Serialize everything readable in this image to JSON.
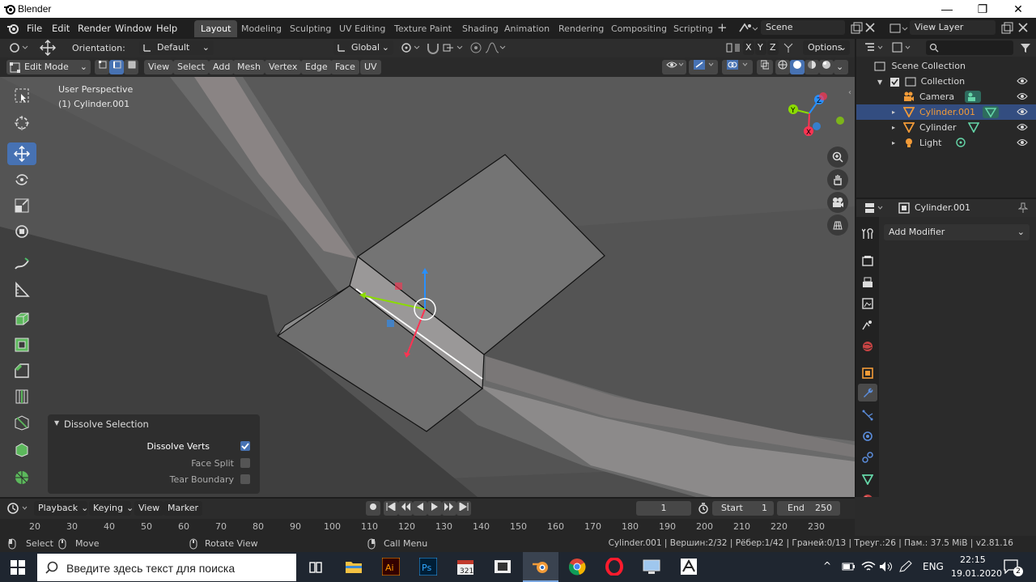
{
  "window": {
    "title": "Blender",
    "minimize": "—",
    "maximize": "❐",
    "close": "✕"
  },
  "menus": [
    "File",
    "Edit",
    "Render",
    "Window",
    "Help"
  ],
  "workspace_tabs": [
    {
      "label": "Layout",
      "active": true
    },
    {
      "label": "Modeling"
    },
    {
      "label": "Sculpting"
    },
    {
      "label": "UV Editing"
    },
    {
      "label": "Texture Paint"
    },
    {
      "label": "Shading"
    },
    {
      "label": "Animation"
    },
    {
      "label": "Rendering"
    },
    {
      "label": "Compositing"
    },
    {
      "label": "Scripting"
    }
  ],
  "add_workspace": "+",
  "scene": "Scene",
  "view_layer": "View Layer",
  "tool_header": {
    "orientation_label": "Orientation:",
    "orientation_value": "Default",
    "transform_orientation": "Global",
    "axis_x": "X",
    "axis_y": "Y",
    "axis_z": "Z",
    "options": "Options"
  },
  "viewport_header": {
    "mode": "Edit Mode",
    "menus": [
      "View",
      "Select",
      "Add",
      "Mesh",
      "Vertex",
      "Edge",
      "Face",
      "UV"
    ]
  },
  "viewport": {
    "perspective": "User Perspective",
    "object": "(1) Cylinder.001"
  },
  "dissolve": {
    "title": "Dissolve Selection",
    "options": [
      {
        "label": "Dissolve Verts",
        "checked": true
      },
      {
        "label": "Face Split",
        "checked": false
      },
      {
        "label": "Tear Boundary",
        "checked": false
      }
    ]
  },
  "outliner": {
    "scene_collection": "Scene Collection",
    "collection": "Collection",
    "items": [
      {
        "name": "Camera",
        "selected": false
      },
      {
        "name": "Cylinder.001",
        "selected": true
      },
      {
        "name": "Cylinder",
        "selected": false
      },
      {
        "name": "Light",
        "selected": false
      }
    ]
  },
  "properties": {
    "object": "Cylinder.001",
    "add_modifier": "Add Modifier"
  },
  "timeline": {
    "menus": [
      "Playback",
      "Keying",
      "View",
      "Marker"
    ],
    "current_frame": "1",
    "start_label": "Start",
    "start": "1",
    "end_label": "End",
    "end": "250",
    "ruler": [
      "20",
      "30",
      "40",
      "50",
      "60",
      "70",
      "80",
      "90",
      "100",
      "110",
      "120",
      "130",
      "140",
      "150",
      "160",
      "170",
      "180",
      "190",
      "200",
      "210",
      "220",
      "230"
    ]
  },
  "statusbar": {
    "select": "Select",
    "move": "Move",
    "rotate": "Rotate View",
    "call_menu": "Call Menu",
    "stats": "Cylinder.001 | Вершин:2/32 | Рёбер:1/42 | Граней:0/13 | Треуг.:26 | Пам.: 37.5 MiB | v2.81.16"
  },
  "taskbar": {
    "search_placeholder": "Введите здесь текст для поиска",
    "lang": "ENG",
    "time": "22:15",
    "date": "19.01.2020",
    "notifications": "2",
    "apps": [
      "task-view",
      "file-explorer",
      "illustrator",
      "photoshop",
      "calendar-app",
      "film-app",
      "blender",
      "chrome",
      "opera",
      "monitor-app",
      "game-app"
    ]
  },
  "colors": {
    "accent": "#4772b3",
    "selection_orange": "#f29b38",
    "x_axis": "#ff3352",
    "y_axis": "#8bdc00",
    "z_axis": "#2890ff"
  }
}
